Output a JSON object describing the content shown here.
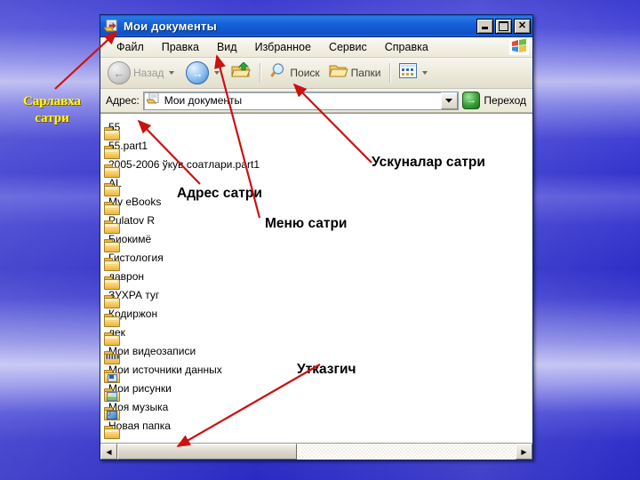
{
  "window": {
    "title": "Мои документы",
    "title_icon": "folder-documents-icon",
    "buttons": {
      "minimize": "_",
      "maximize": "□",
      "close": "✕"
    }
  },
  "menubar": {
    "items": [
      {
        "label": "Файл"
      },
      {
        "label": "Правка"
      },
      {
        "label": "Вид"
      },
      {
        "label": "Избранное"
      },
      {
        "label": "Сервис"
      },
      {
        "label": "Справка"
      }
    ],
    "brand_icon": "windows-flag-icon"
  },
  "toolbar": {
    "back": {
      "label": "Назад",
      "icon": "arrow-left-icon"
    },
    "forward": {
      "label": "",
      "icon": "arrow-right-icon"
    },
    "up": {
      "label": "",
      "icon": "folder-up-icon"
    },
    "search": {
      "label": "Поиск",
      "icon": "magnifier-icon"
    },
    "folders": {
      "label": "Папки",
      "icon": "folder-open-icon"
    },
    "views": {
      "label": "",
      "icon": "views-icon"
    }
  },
  "addressbar": {
    "label": "Адрес:",
    "value": "Мои документы",
    "icon": "folder-documents-icon",
    "dropdown_icon": "chevron-down-icon",
    "go": {
      "label": "Переход",
      "icon": "green-arrow-right-icon"
    }
  },
  "files": [
    {
      "name": "55",
      "icon": "folder-icon",
      "kind": "folder"
    },
    {
      "name": "55.part1",
      "icon": "folder-icon",
      "kind": "folder"
    },
    {
      "name": "2005-2006 ўкув соатлари.part1",
      "icon": "folder-icon",
      "kind": "folder"
    },
    {
      "name": "AL",
      "icon": "folder-icon",
      "kind": "folder"
    },
    {
      "name": "My eBooks",
      "icon": "folder-icon",
      "kind": "folder"
    },
    {
      "name": "Pulatov R",
      "icon": "folder-icon",
      "kind": "folder"
    },
    {
      "name": "Биокимё",
      "icon": "folder-icon",
      "kind": "folder"
    },
    {
      "name": "Гистология",
      "icon": "folder-icon",
      "kind": "folder"
    },
    {
      "name": "даврон",
      "icon": "folder-icon",
      "kind": "folder"
    },
    {
      "name": "ЗУХРА туг",
      "icon": "folder-icon",
      "kind": "folder"
    },
    {
      "name": "Кодиржон",
      "icon": "folder-icon",
      "kind": "folder"
    },
    {
      "name": "лек",
      "icon": "folder-icon",
      "kind": "folder"
    },
    {
      "name": "Мои видеозаписи",
      "icon": "folder-video-icon",
      "kind": "video"
    },
    {
      "name": "Мои источники данных",
      "icon": "folder-datasource-icon",
      "kind": "data"
    },
    {
      "name": "Мои рисунки",
      "icon": "folder-pictures-icon",
      "kind": "pic"
    },
    {
      "name": "Моя музыка",
      "icon": "folder-music-icon",
      "kind": "music"
    },
    {
      "name": "Новая папка",
      "icon": "folder-icon",
      "kind": "folder"
    }
  ],
  "scrollbar": {
    "left_arrow": "◀",
    "right_arrow": "▶"
  },
  "annotations": {
    "title_bar": "Сарлавха\nсатри",
    "toolbar": "Ускуналар сатри",
    "address_bar": "Адрес сатри",
    "menu_bar": "Меню сатри",
    "slider": "Утказгич"
  },
  "colors": {
    "annotation_arrow": "#cc1111",
    "title_annotation": "#ffff00",
    "titlebar_blue": "#1661d8",
    "desktop_blue": "#3434cd",
    "window_face": "#ece9d8"
  }
}
